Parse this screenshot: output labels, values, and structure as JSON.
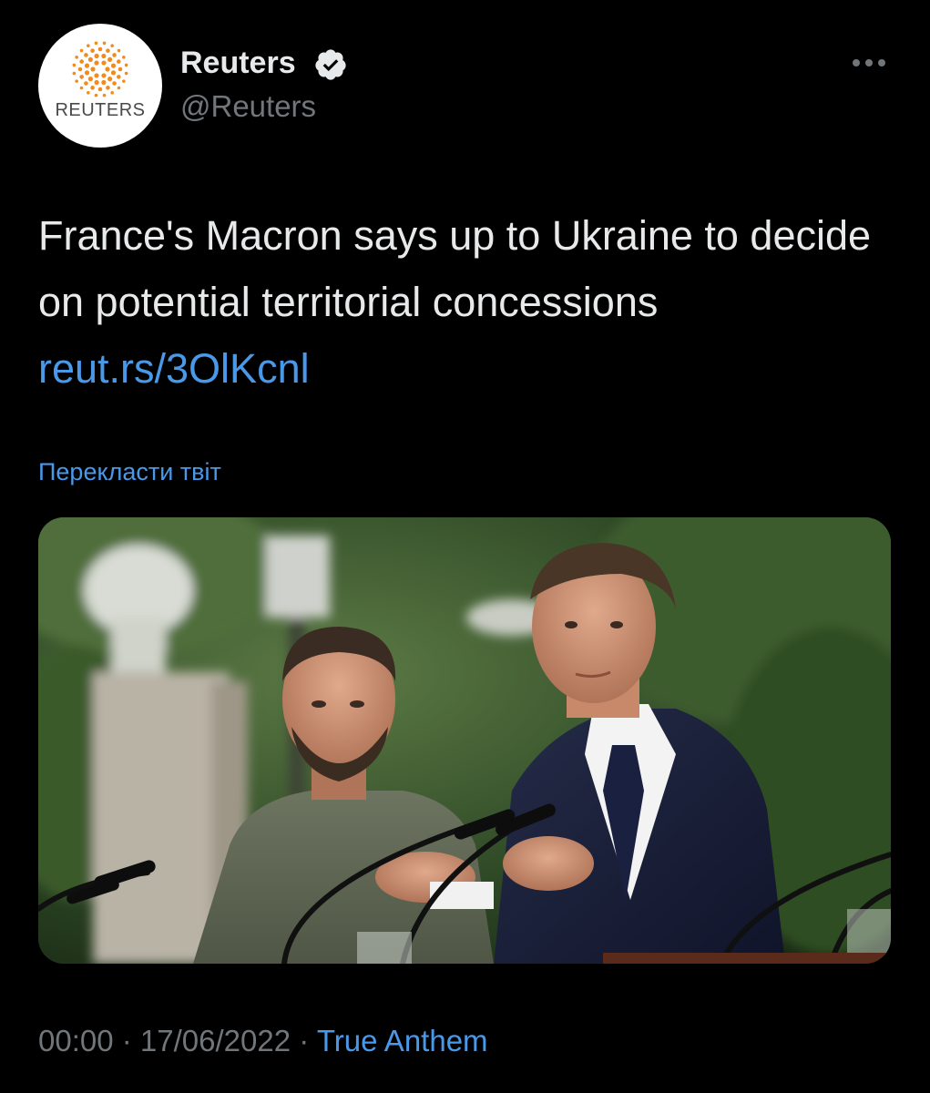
{
  "tweet": {
    "author": {
      "display_name": "Reuters",
      "handle": "@Reuters",
      "avatar_logo_text": "REUTERS",
      "verified": true
    },
    "text": "France's Macron says up to Ukraine to decide on potential territorial concessions",
    "link": "reut.rs/3OlKcnl",
    "translate_label": "Перекласти твіт",
    "time": "00:00",
    "separator": " · ",
    "date": "17/06/2022",
    "source": "True Anthem"
  },
  "icons": {
    "verified": "verified-badge-icon",
    "more": "more-horizontal-icon"
  },
  "colors": {
    "background": "#000000",
    "text": "#e7e9ea",
    "secondary": "#71767b",
    "link": "#4a99e9",
    "reuters_orange": "#f28b1e"
  }
}
